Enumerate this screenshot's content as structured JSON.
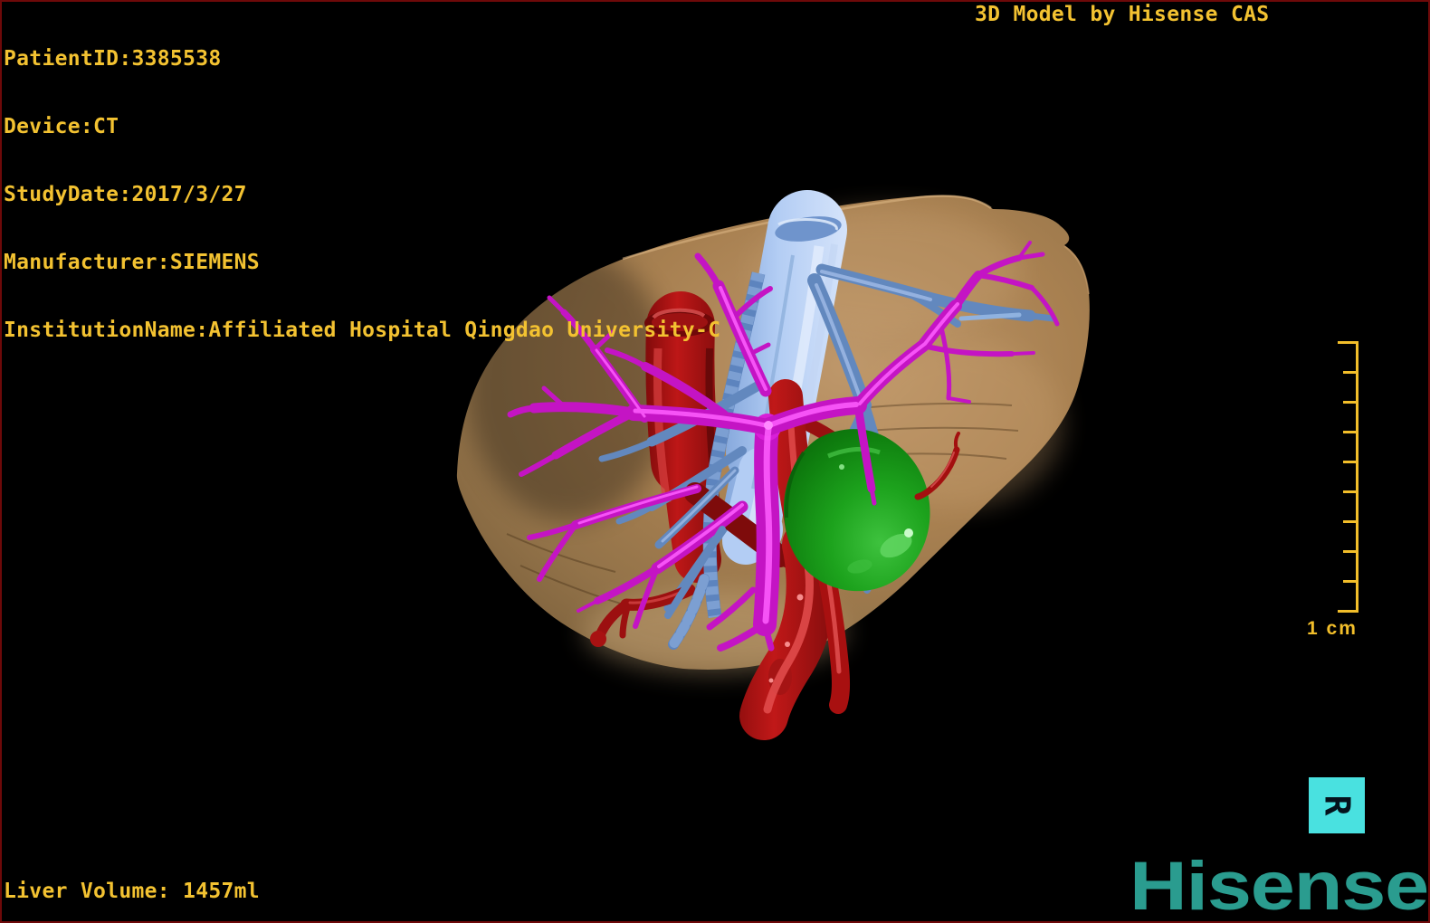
{
  "header": {
    "patient_info_lines": [
      "PatientID:3385538",
      "Device:CT",
      "StudyDate:2017/3/27",
      "Manufacturer:SIEMENS",
      "InstitutionName:Affiliated Hospital Qingdao University-C"
    ],
    "credit": "3D Model by Hisense CAS"
  },
  "footer": {
    "liver_volume": "Liver Volume: 1457ml"
  },
  "scale_bar": {
    "label": "1 cm",
    "tick_count": 10
  },
  "orientation_marker": {
    "label": "R"
  },
  "branding": {
    "logo": "Hisense"
  },
  "colors": {
    "overlay_text": "#F3C231",
    "scale_bar": "#F2BE2A",
    "marker_box": "#49E1E0",
    "logo": "#2A9C8F",
    "frame_border": "#6E0909",
    "background": "#000000",
    "liver": "#B08655",
    "portal_vein": "#C414C4",
    "hepatic_veins": "#6288BE",
    "inferior_vena_cava": "#A9C6F0",
    "artery": "#A81010",
    "gallbladder": "#15A015"
  },
  "model": {
    "structures": [
      {
        "name": "liver",
        "color": "#B08655"
      },
      {
        "name": "inferior-vena-cava",
        "color": "#A9C6F0"
      },
      {
        "name": "hepatic-veins",
        "color": "#6288BE"
      },
      {
        "name": "portal-vein",
        "color": "#C414C4"
      },
      {
        "name": "hepatic-artery-aorta",
        "color": "#A81010"
      },
      {
        "name": "gallbladder",
        "color": "#15A015"
      }
    ]
  }
}
